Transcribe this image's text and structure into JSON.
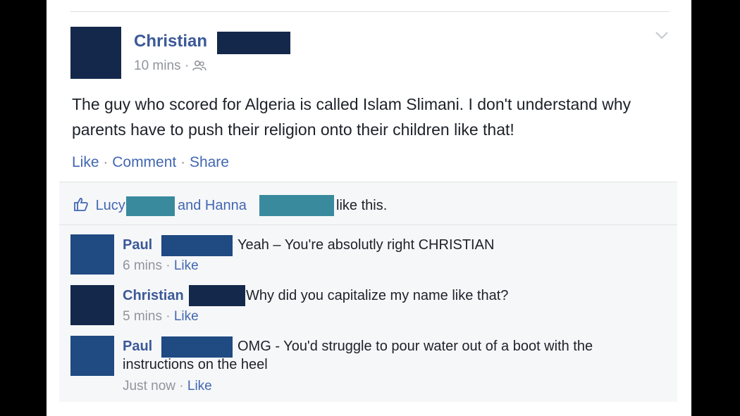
{
  "post": {
    "author_first_name": "Christian",
    "time": "10 mins",
    "meta_separator": "·",
    "text": "The guy who scored for Algeria is called Islam Slimani. I don't understand why parents have to push their religion onto their children like that!",
    "actions": {
      "like": "Like",
      "comment": "Comment",
      "share": "Share",
      "separator": "·"
    },
    "options_icon": "chevron-down-icon",
    "audience_icon": "friends-icon"
  },
  "likes": {
    "icon": "thumbs-up-icon",
    "name_1": "Lucy",
    "connector": "and Hanna",
    "suffix": "like this."
  },
  "comments": [
    {
      "name": "Paul",
      "text": "Yeah – You're absolutly right CHRISTIAN",
      "time": "6 mins",
      "like": "Like"
    },
    {
      "name": "Christian",
      "text": "Why did you capitalize my name like that?",
      "time": "5 mins",
      "like": "Like"
    },
    {
      "name": "Paul",
      "text": "OMG - You'd struggle to pour water out of a boot with the instructions on the heel",
      "time": "Just now",
      "like": "Like"
    }
  ],
  "meta_separator": "·",
  "colors": {
    "link_blue": "#3b5998",
    "action_blue": "#4267b2",
    "gray_text": "#90949c",
    "redaction_navy": "#14284b",
    "redaction_teal": "#3a8a9e",
    "comment_bg": "#f6f7f9"
  }
}
